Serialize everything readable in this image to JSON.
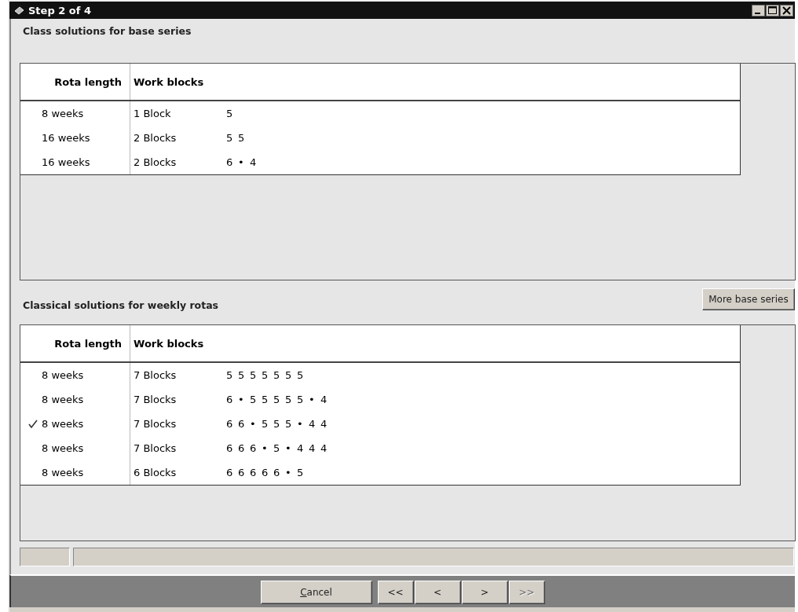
{
  "window": {
    "title": "Step 2 of 4"
  },
  "sections": [
    {
      "title": "Class solutions for base series",
      "columns": [
        "Rota length",
        "Work blocks"
      ],
      "rows": [
        {
          "rota_length": "8 weeks",
          "blocks": "1 Block",
          "sequence": [
            "5"
          ],
          "selected": false
        },
        {
          "rota_length": "16 weeks",
          "blocks": "2 Blocks",
          "sequence": [
            "5",
            "5"
          ],
          "selected": false
        },
        {
          "rota_length": "16 weeks",
          "blocks": "2 Blocks",
          "sequence": [
            "6",
            "•",
            "4"
          ],
          "selected": false
        }
      ]
    },
    {
      "title": "Classical solutions for weekly rotas",
      "action_button": "More base series",
      "columns": [
        "Rota length",
        "Work blocks"
      ],
      "rows": [
        {
          "rota_length": "8 weeks",
          "blocks": "7 Blocks",
          "sequence": [
            "5",
            "5",
            "5",
            "5",
            "5",
            "5",
            "5"
          ],
          "selected": false
        },
        {
          "rota_length": "8 weeks",
          "blocks": "7 Blocks",
          "sequence": [
            "6",
            "•",
            "5",
            "5",
            "5",
            "5",
            "5",
            "•",
            "4"
          ],
          "selected": false
        },
        {
          "rota_length": "8 weeks",
          "blocks": "7 Blocks",
          "sequence": [
            "6",
            "6",
            "•",
            "5",
            "5",
            "5",
            "•",
            "4",
            "4"
          ],
          "selected": true
        },
        {
          "rota_length": "8 weeks",
          "blocks": "7 Blocks",
          "sequence": [
            "6",
            "6",
            "6",
            "•",
            "5",
            "•",
            "4",
            "4",
            "4"
          ],
          "selected": false
        },
        {
          "rota_length": "8 weeks",
          "blocks": "6 Blocks",
          "sequence": [
            "6",
            "6",
            "6",
            "6",
            "6",
            "•",
            "5"
          ],
          "selected": false
        }
      ]
    }
  ],
  "footer_buttons": [
    {
      "label": "Cancel",
      "underline_first": true,
      "disabled": false,
      "kind": "wide"
    },
    {
      "label": "<<",
      "underline_first": false,
      "disabled": false,
      "kind": "nav"
    },
    {
      "label": "<",
      "underline_first": false,
      "disabled": false,
      "kind": "nav"
    },
    {
      "label": ">",
      "underline_first": false,
      "disabled": false,
      "kind": "nav"
    },
    {
      "label": ">>",
      "underline_first": false,
      "disabled": true,
      "kind": "nav"
    }
  ]
}
